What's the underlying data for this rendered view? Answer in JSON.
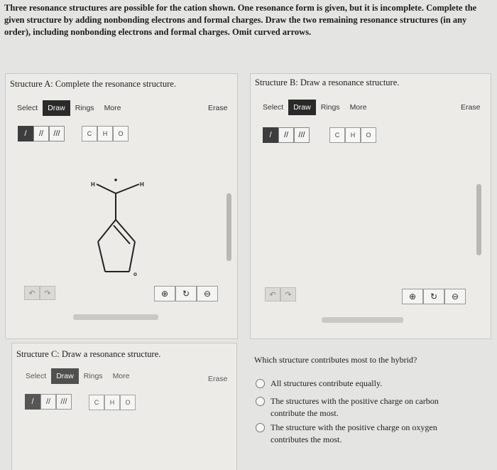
{
  "instructions": "Three resonance structures are possible for the cation shown. One resonance form is given, but it is incomplete. Complete the given structure by adding nonbonding electrons and formal charges. Draw the two remaining resonance structures (in any order), including nonbonding electrons and formal charges. Omit curved arrows.",
  "panels": {
    "a": {
      "title": "Structure A: Complete the resonance structure."
    },
    "b": {
      "title": "Structure B: Draw a resonance structure."
    },
    "c": {
      "title": "Structure C: Draw a resonance structure."
    }
  },
  "toolbar": {
    "select": "Select",
    "draw": "Draw",
    "rings": "Rings",
    "more": "More",
    "erase": "Erase"
  },
  "bonds": {
    "single": "/",
    "double": "//",
    "triple": "///"
  },
  "atoms": {
    "c": "C",
    "h": "H",
    "o": "O"
  },
  "icons": {
    "undo": "undo-icon",
    "redo": "redo-icon",
    "zoom_in": "zoom-in-icon",
    "reset": "reset-zoom-icon",
    "zoom_out": "zoom-out-icon"
  },
  "molecule": {
    "h_left": "H",
    "h_right": "H",
    "oxygen": "o"
  },
  "question": "Which structure contributes most to the hybrid?",
  "options": [
    "All structures contribute equally.",
    "The structures with the positive charge on carbon contribute the most.",
    "The structure with the positive charge on oxygen contributes the most."
  ],
  "colors": {
    "active": "#2a2a2a",
    "panel": "#ecebe8",
    "background": "#e4e4e2"
  }
}
